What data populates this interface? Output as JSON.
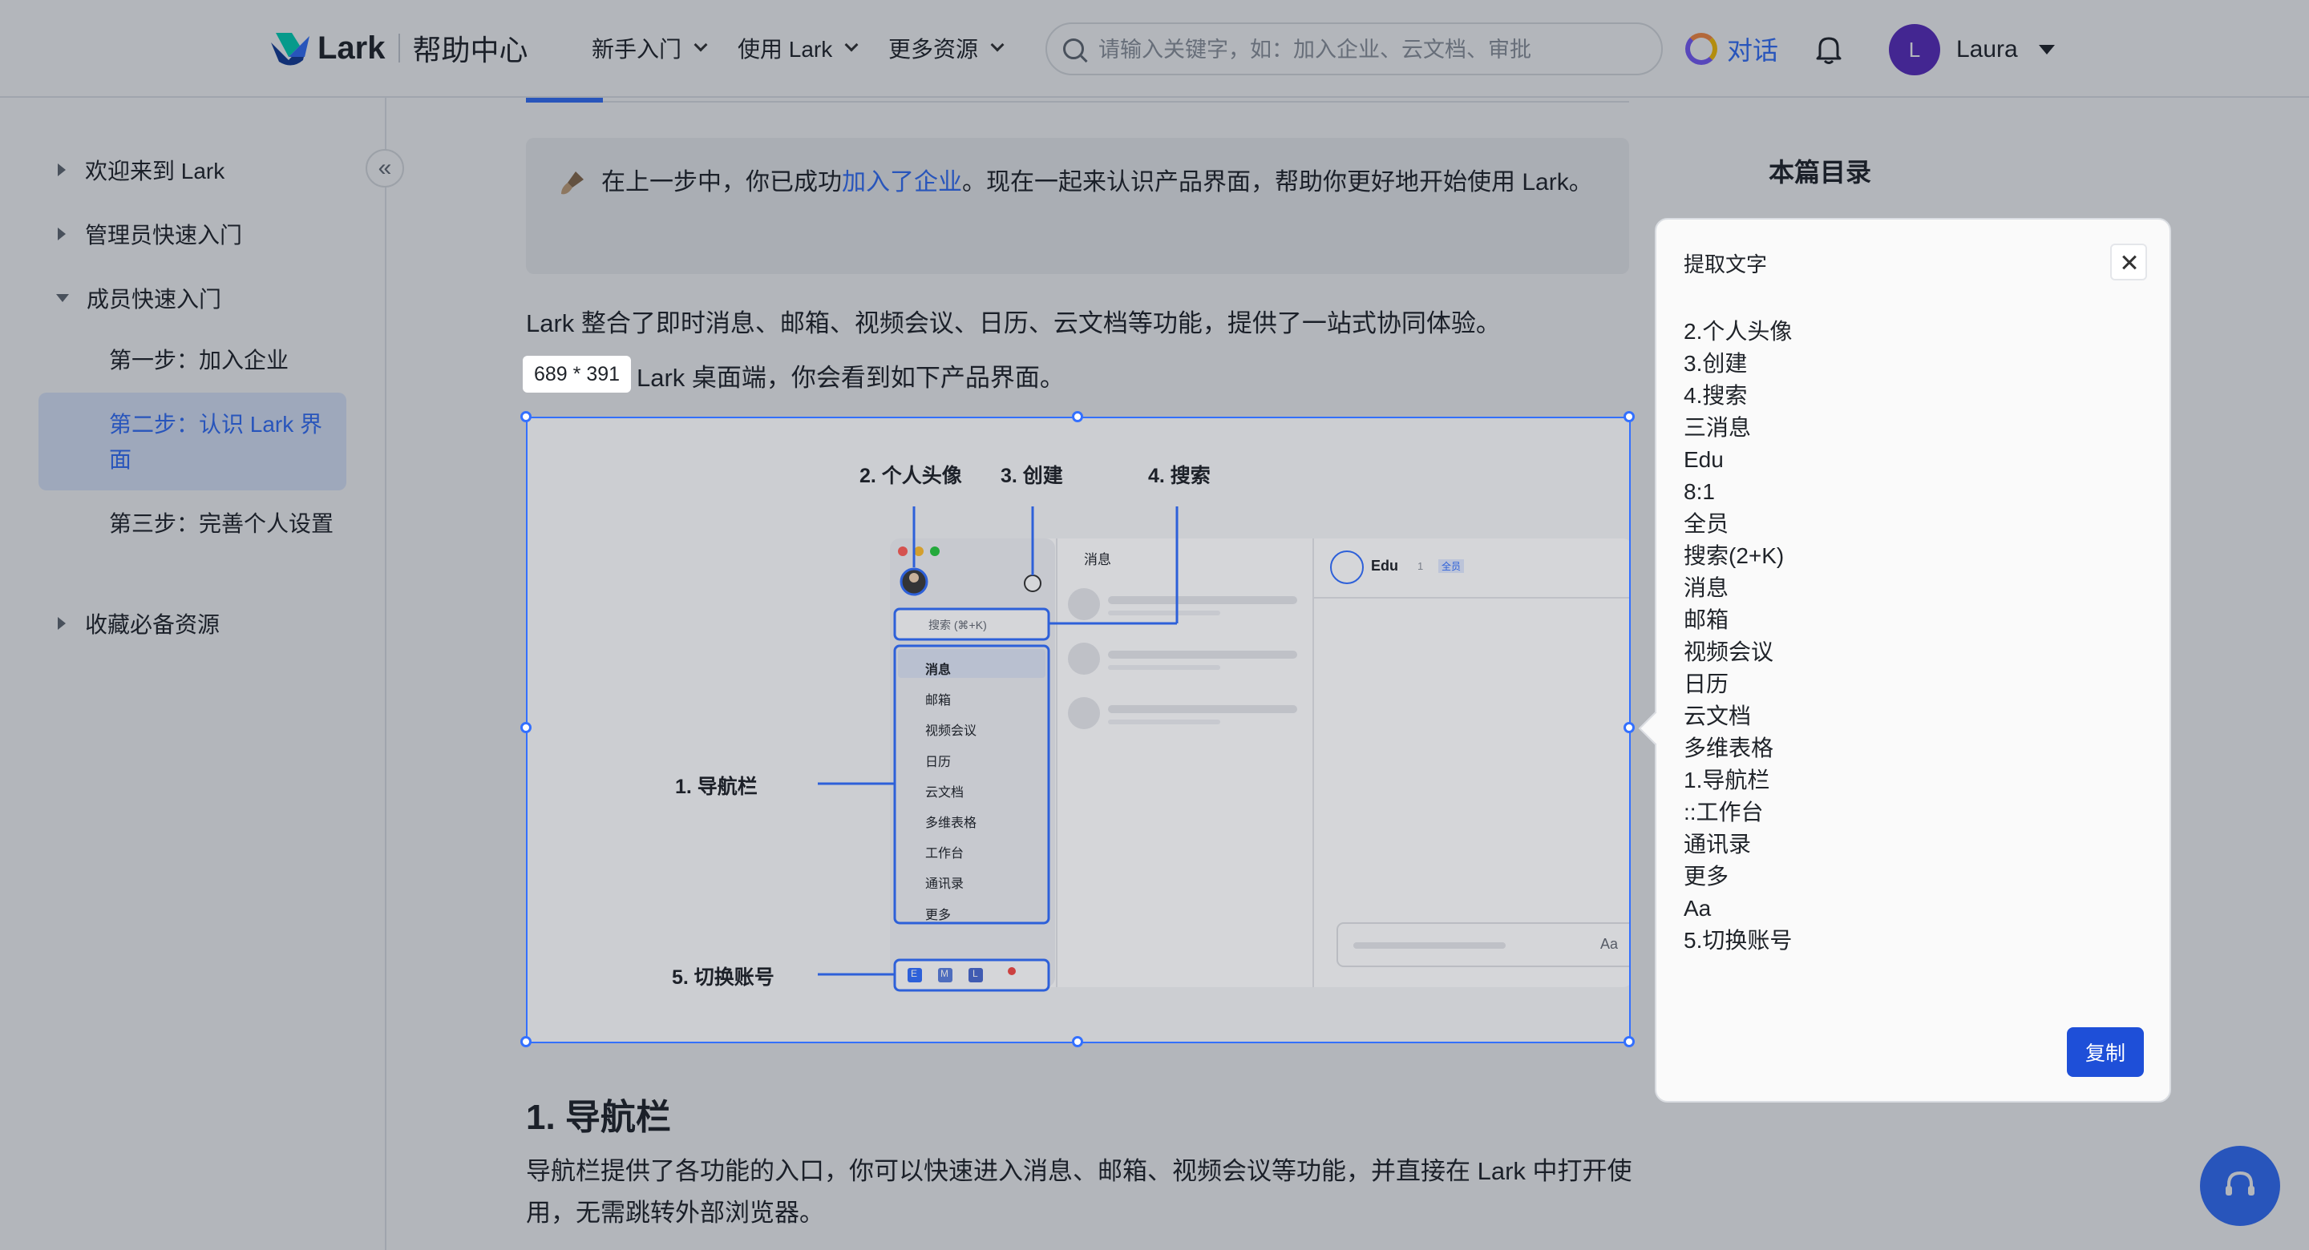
{
  "header": {
    "logo_text": "Lark",
    "logo_subtitle": "帮助中心",
    "nav": [
      {
        "label": "新手入门"
      },
      {
        "label": "使用 Lark"
      },
      {
        "label": "更多资源"
      }
    ],
    "search_placeholder": "请输入关键字，如：加入企业、云文档、审批",
    "chat_label": "对话",
    "user_initial": "L",
    "user_name": "Laura"
  },
  "sidebar": {
    "collapse_icon": "«",
    "items": [
      {
        "label": "欢迎来到 Lark"
      },
      {
        "label": "管理员快速入门"
      },
      {
        "label": "成员快速入门"
      },
      {
        "label": "收藏必备资源"
      }
    ],
    "sub_items": [
      {
        "label": "第一步：加入企业"
      },
      {
        "label": "第二步：认识 Lark 界面"
      },
      {
        "label": "第三步：完善个人设置"
      }
    ]
  },
  "main": {
    "callout_before": "在上一步中，你已成功",
    "callout_link": "加入了企业",
    "callout_after": "。现在一起来认识产品界面，帮助你更好地开始使用 Lark。",
    "para1": "Lark 整合了即时消息、邮箱、视频会议、日历、云文档等功能，提供了一站式协同体验。",
    "para2": "Lark 桌面端，你会看到如下产品界面。",
    "dimension_tag": "689 * 391",
    "heading": "1. 导航栏",
    "para3": "导航栏提供了各功能的入口，你可以快速进入消息、邮箱、视频会议等功能，并直接在 Lark 中打开使用，无需跳转外部浏览器。",
    "toc_title": "本篇目录"
  },
  "figure": {
    "callouts": {
      "avatar": "2. 个人头像",
      "create": "3. 创建",
      "search": "4. 搜索",
      "nav": "1. 导航栏",
      "switch": "5. 切换账号"
    },
    "app_search": "搜索 (⌘+K)",
    "nav_items": [
      "消息",
      "邮箱",
      "视频会议",
      "日历",
      "云文档",
      "多维表格",
      "工作台",
      "通讯录",
      "更多"
    ],
    "list_header": "消息",
    "chat_name": "Edu",
    "chat_count": "1",
    "chat_badge": "全员",
    "input_icon": "Aa",
    "account_badges": [
      "E",
      "M",
      "L"
    ]
  },
  "extract_panel": {
    "title": "提取文字",
    "lines": [
      "2.个人头像",
      "3.创建",
      "4.搜索",
      "三消息",
      "Edu",
      "8:1",
      "全员",
      "搜索(2+K)",
      "消息",
      "邮箱",
      "视频会议",
      "日历",
      "云文档",
      "多维表格",
      "1.导航栏",
      "::工作台",
      "通讯录",
      "更多",
      "Aa",
      "5.切换账号"
    ],
    "copy_label": "复制"
  }
}
